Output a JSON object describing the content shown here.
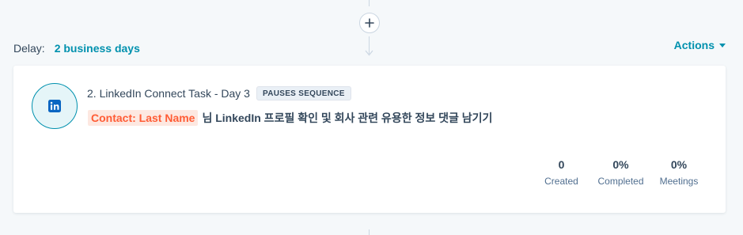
{
  "add_step": {
    "icon": "plus-icon"
  },
  "delay": {
    "label": "Delay:",
    "value": "2 business days"
  },
  "actions": {
    "label": "Actions",
    "icon": "caret-down-icon"
  },
  "step": {
    "icon": "linkedin-icon",
    "title": "2. LinkedIn Connect Task - Day 3",
    "badge": "PAUSES SEQUENCE",
    "token": "Contact: Last Name",
    "body_text": "님 LinkedIn 프로필 확인 및 회사 관련 유용한 정보 댓글 남기기"
  },
  "stats": {
    "created": {
      "value": "0",
      "label": "Created"
    },
    "completed": {
      "value": "0%",
      "label": "Completed"
    },
    "meetings": {
      "value": "0%",
      "label": "Meetings"
    }
  },
  "colors": {
    "accent": "#0091ae",
    "token_text": "#ff5c35",
    "token_bg": "#fde8e1",
    "text": "#33475b",
    "page_bg": "#f5f8fa"
  }
}
